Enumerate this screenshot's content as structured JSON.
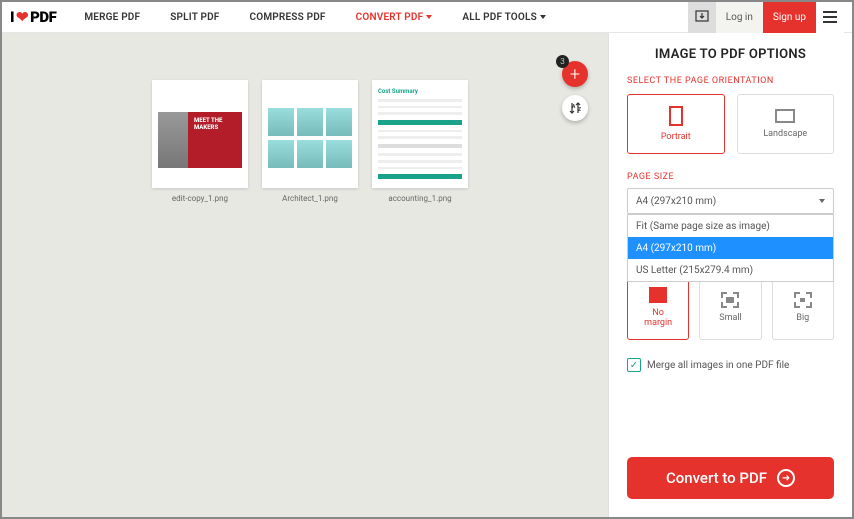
{
  "logo": {
    "prefix": "I",
    "suffix": "PDF"
  },
  "nav": {
    "merge": "MERGE PDF",
    "split": "SPLIT PDF",
    "compress": "COMPRESS PDF",
    "convert": "CONVERT PDF",
    "all": "ALL PDF TOOLS"
  },
  "top_right": {
    "login": "Log in",
    "signup": "Sign up"
  },
  "canvas": {
    "badge_count": "3",
    "thumbs": {
      "t1": {
        "label": "edit-copy_1.png",
        "redtext": "MEET THE\nMAKERS"
      },
      "t2": {
        "label": "Architect_1.png"
      },
      "t3": {
        "label": "accounting_1.png",
        "title": "Cost Summary"
      }
    }
  },
  "panel": {
    "title": "IMAGE TO PDF OPTIONS",
    "orientation_label": "SELECT THE PAGE ORIENTATION",
    "portrait": "Portrait",
    "landscape": "Landscape",
    "page_size_label": "PAGE SIZE",
    "dropdown_selected": "A4 (297x210 mm)",
    "dropdown": {
      "fit": "Fit (Same page size as image)",
      "a4": "A4 (297x210 mm)",
      "letter": "US Letter (215x279.4 mm)"
    },
    "margin": {
      "none": "No\nmargin",
      "small": "Small",
      "big": "Big"
    },
    "merge_check": "Merge all images in one PDF file",
    "convert": "Convert to PDF"
  }
}
